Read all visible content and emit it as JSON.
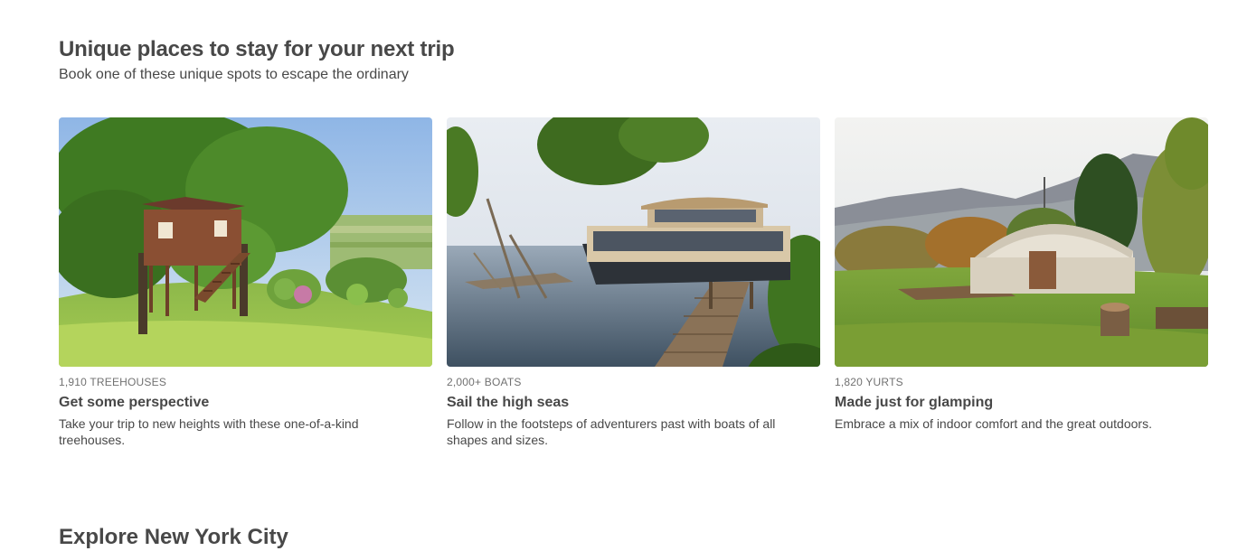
{
  "section": {
    "title": "Unique places to stay for your next trip",
    "subtitle": "Book one of these unique spots to escape the ordinary"
  },
  "cards": [
    {
      "eyebrow": "1,910 TREEHOUSES",
      "title": "Get some perspective",
      "description": "Take your trip to new heights with these one-of-a-kind treehouses.",
      "image": "treehouse-photo"
    },
    {
      "eyebrow": "2,000+ BOATS",
      "title": "Sail the high seas",
      "description": "Follow in the footsteps of adventurers past with boats of all shapes and sizes.",
      "image": "houseboat-photo"
    },
    {
      "eyebrow": "1,820 YURTS",
      "title": "Made just for glamping",
      "description": "Embrace a mix of indoor comfort and the great outdoors.",
      "image": "yurt-photo"
    }
  ],
  "next_section": {
    "title": "Explore New York City"
  }
}
